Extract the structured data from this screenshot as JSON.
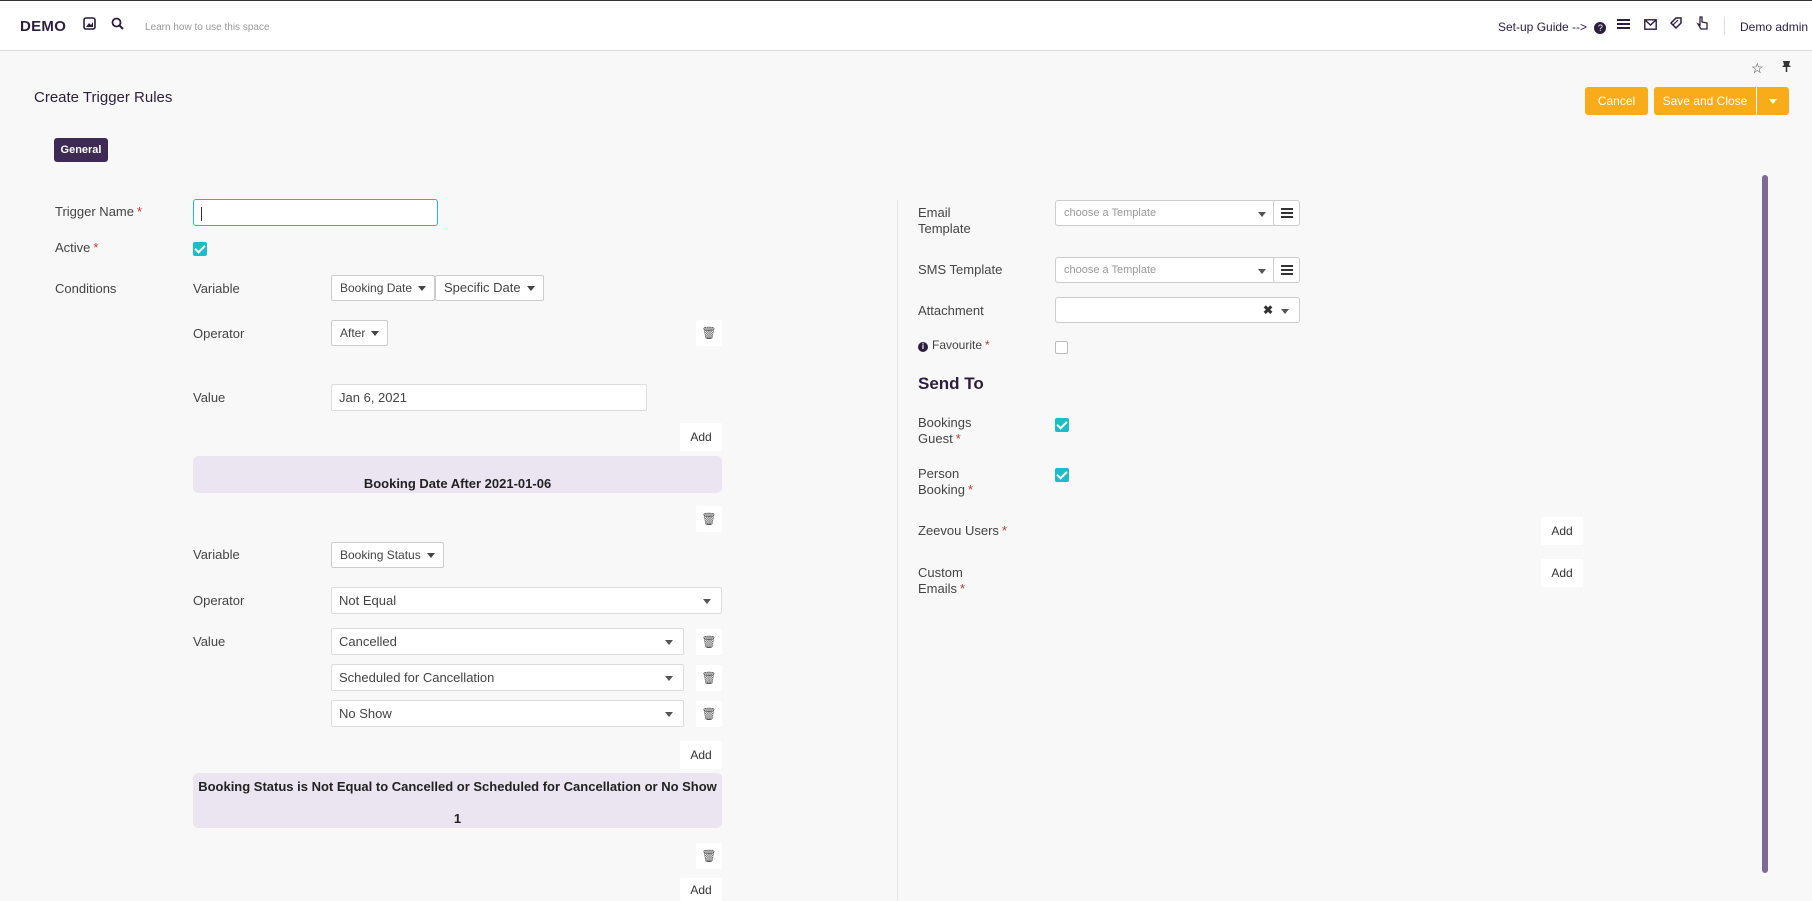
{
  "topbar": {
    "logo": "DEMO",
    "learn": "Learn how to use this space",
    "setup_guide": "Set-up Guide -->",
    "user": "Demo admin",
    "icons": [
      "image-icon",
      "search-icon",
      "help-icon",
      "menu-icon",
      "mail-icon",
      "tag-icon",
      "pointer-icon"
    ]
  },
  "page": {
    "title": "Create Trigger Rules",
    "cancel": "Cancel",
    "save_close": "Save and Close",
    "tab": "General"
  },
  "form": {
    "trigger_name_label": "Trigger Name",
    "trigger_name_value": "",
    "active_label": "Active",
    "active_checked": true,
    "conditions_label": "Conditions",
    "required_marker": "*",
    "cond1": {
      "variable_label": "Variable",
      "variable": "Booking Date",
      "variable_sub": "Specific Date",
      "operator_label": "Operator",
      "operator": "After",
      "value_label": "Value",
      "value": "Jan 6, 2021",
      "add": "Add",
      "summary": "Booking Date After 2021-01-06"
    },
    "cond2": {
      "variable_label": "Variable",
      "variable": "Booking Status",
      "operator_label": "Operator",
      "operator": "Not Equal",
      "value_label": "Value",
      "values": [
        "Cancelled",
        "Scheduled for Cancellation",
        "No Show"
      ],
      "add": "Add",
      "summary": "Booking Status is Not Equal to Cancelled or Scheduled for Cancellation or No Show",
      "summary_count": "1"
    },
    "bottom_add": "Add"
  },
  "right": {
    "email_template_label": "Email Template",
    "email_template_placeholder": "choose a Template",
    "sms_template_label": "SMS Template",
    "sms_template_placeholder": "choose a Template",
    "attachment_label": "Attachment",
    "favourite_label": "Favourite",
    "favourite_checked": false,
    "send_to": "Send To",
    "bookings_guest_label": "Bookings Guest",
    "bookings_guest_checked": true,
    "person_booking_label": "Person Booking",
    "person_booking_checked": true,
    "zeevou_users_label": "Zeevou Users",
    "custom_emails_label": "Custom Emails",
    "add": "Add"
  },
  "colors": {
    "accent": "#f9ac1a",
    "brand": "#3d2b55",
    "checkbox": "#1dbcc7",
    "summary_bg": "#ebe4f1"
  }
}
